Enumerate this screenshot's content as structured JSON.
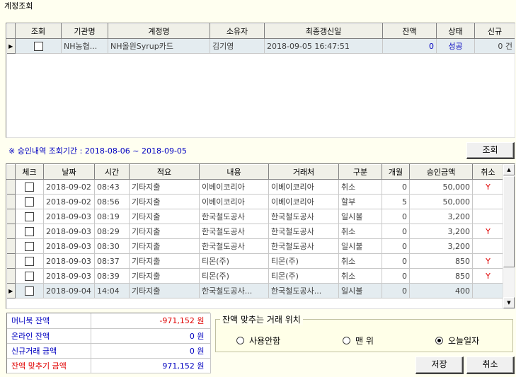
{
  "title": "계정조회",
  "accounts": {
    "columns": [
      "조회",
      "기관명",
      "계정명",
      "소유자",
      "최종갱신일",
      "잔액",
      "상태",
      "신규"
    ],
    "rows": [
      {
        "checked": false,
        "institution": "NH농협...",
        "account": "NH올원Syrup카드",
        "owner": "김기영",
        "updated": "2018-09-05 16:47:51",
        "balance": "0",
        "status": "성공",
        "new": "0 건"
      }
    ]
  },
  "approval": {
    "period_label": "※ 승인내역  조회기간  : 2018-08-06  ~  2018-09-05",
    "query_button": "조회",
    "columns": [
      "체크",
      "날짜",
      "시간",
      "적요",
      "내용",
      "거래처",
      "구분",
      "개월",
      "승인금액",
      "취소"
    ],
    "rows": [
      {
        "date": "2018-09-02",
        "time": "08:43",
        "memo": "기타지출",
        "content": "이베이코리아",
        "vendor": "이베이코리아",
        "type": "취소",
        "months": "0",
        "amount": "50,000",
        "cancel": "Y"
      },
      {
        "date": "2018-09-02",
        "time": "08:56",
        "memo": "기타지출",
        "content": "이베이코리아",
        "vendor": "이베이코리아",
        "type": "할부",
        "months": "5",
        "amount": "50,000",
        "cancel": ""
      },
      {
        "date": "2018-09-03",
        "time": "08:19",
        "memo": "기타지출",
        "content": "한국철도공사",
        "vendor": "한국철도공사",
        "type": "일시불",
        "months": "0",
        "amount": "3,200",
        "cancel": ""
      },
      {
        "date": "2018-09-03",
        "time": "08:29",
        "memo": "기타지출",
        "content": "한국철도공사",
        "vendor": "한국철도공사",
        "type": "취소",
        "months": "0",
        "amount": "3,200",
        "cancel": "Y"
      },
      {
        "date": "2018-09-03",
        "time": "08:30",
        "memo": "기타지출",
        "content": "한국철도공사",
        "vendor": "한국철도공사",
        "type": "일시불",
        "months": "0",
        "amount": "3,200",
        "cancel": ""
      },
      {
        "date": "2018-09-03",
        "time": "08:37",
        "memo": "기타지출",
        "content": "티몬(주)",
        "vendor": "티몬(주)",
        "type": "취소",
        "months": "0",
        "amount": "850",
        "cancel": "Y"
      },
      {
        "date": "2018-09-03",
        "time": "08:39",
        "memo": "기타지출",
        "content": "티몬(주)",
        "vendor": "티몬(주)",
        "type": "취소",
        "months": "0",
        "amount": "850",
        "cancel": "Y"
      },
      {
        "date": "2018-09-04",
        "time": "14:04",
        "memo": "기타지출",
        "content": "한국철도공사...",
        "vendor": "한국철도공사...",
        "type": "일시불",
        "months": "0",
        "amount": "400",
        "cancel": ""
      }
    ],
    "current_row": 7
  },
  "summary": [
    {
      "label": "머니북 잔액",
      "value": "-971,152 원",
      "color": "red-value"
    },
    {
      "label": "온라인 잔액",
      "value": "0 원",
      "color": "blue"
    },
    {
      "label": "신규거래 금액",
      "value": "0 원",
      "color": "blue"
    },
    {
      "label": "잔액 맞추기 금액",
      "value": "971,152 원",
      "color": "red-label"
    }
  ],
  "position_group": {
    "title": "잔액 맞추는 거래 위치",
    "options": [
      {
        "label": "사용안함",
        "selected": false
      },
      {
        "label": "맨 위",
        "selected": false
      },
      {
        "label": "오늘일자",
        "selected": true
      }
    ]
  },
  "buttons": {
    "save": "저장",
    "cancel": "취소"
  },
  "colors": {
    "background": "#fffff0",
    "accent_blue": "#0000c0",
    "accent_red": "#e00000",
    "selected_row": "#e4ecf0"
  },
  "icons": {
    "row_pointer": "row-pointer-icon",
    "scroll_up": "scroll-up-icon",
    "scroll_down": "scroll-down-icon"
  }
}
